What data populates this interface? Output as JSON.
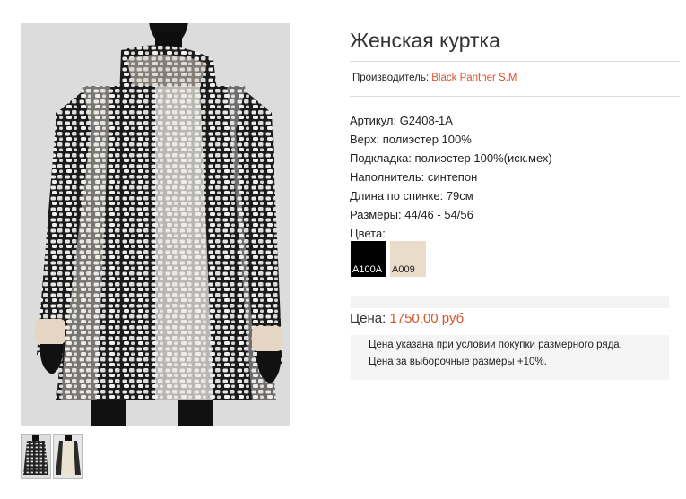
{
  "product": {
    "title": "Женская куртка",
    "manufacturer_label": "Производитель:",
    "manufacturer_name": "Black Panther S.M"
  },
  "specs": [
    "Артикул: G2408-1A",
    "Верх: полиэстер 100%",
    "Подкладка: полиэстер 100%(иск.мех)",
    "Наполнитель: синтепон",
    "Длина по спинке: 79см",
    "Размеры: 44/46 - 54/56",
    "Цвета:"
  ],
  "colors": [
    {
      "code": "A100A",
      "color": "#000000"
    },
    {
      "code": "A009",
      "color": "#e9dccb"
    }
  ],
  "price": {
    "label": "Цена:",
    "value": "1750,00 руб"
  },
  "notes": [
    "Цена указана при условии покупки размерного ряда.",
    "Цена за выборочные размеры +10%."
  ],
  "theme": {
    "accent": "#d9532b"
  }
}
